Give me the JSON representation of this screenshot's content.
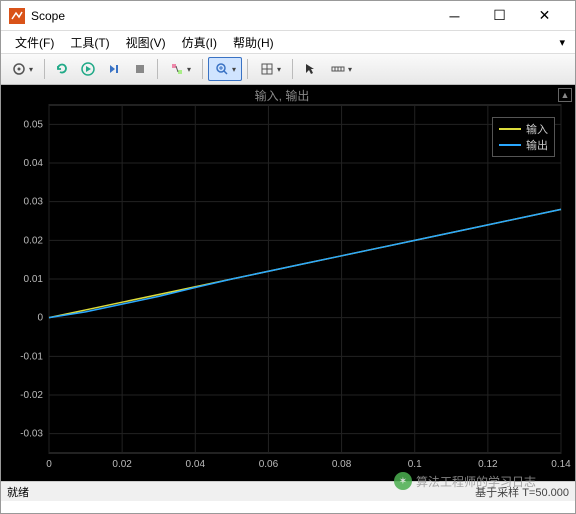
{
  "window": {
    "title": "Scope"
  },
  "menu": {
    "file": "文件(F)",
    "tools": "工具(T)",
    "view": "视图(V)",
    "simulation": "仿真(I)",
    "help": "帮助(H)"
  },
  "chart_data": {
    "type": "line",
    "title": "输入, 输出",
    "xlabel": "",
    "ylabel": "",
    "xlim": [
      0,
      0.14
    ],
    "ylim": [
      -0.035,
      0.055
    ],
    "xticks": [
      0,
      0.02,
      0.04,
      0.06,
      0.08,
      0.1,
      0.12,
      0.14
    ],
    "yticks": [
      -0.03,
      -0.02,
      -0.01,
      0,
      0.01,
      0.02,
      0.03,
      0.04,
      0.05
    ],
    "series": [
      {
        "name": "输入",
        "color": "#dcdc3c",
        "x": [
          0,
          0.01,
          0.02,
          0.03,
          0.04,
          0.05,
          0.06,
          0.07,
          0.08,
          0.09,
          0.1,
          0.11,
          0.12,
          0.13,
          0.14
        ],
        "y": [
          0,
          0.002,
          0.004,
          0.006,
          0.008,
          0.01,
          0.012,
          0.014,
          0.016,
          0.018,
          0.02,
          0.022,
          0.024,
          0.026,
          0.028
        ]
      },
      {
        "name": "输出",
        "color": "#2aa8ff",
        "x": [
          0,
          0.01,
          0.02,
          0.03,
          0.04,
          0.05,
          0.06,
          0.07,
          0.08,
          0.09,
          0.1,
          0.11,
          0.12,
          0.13,
          0.14
        ],
        "y": [
          0,
          0.0015,
          0.0035,
          0.0055,
          0.0078,
          0.01,
          0.012,
          0.014,
          0.016,
          0.018,
          0.02,
          0.022,
          0.024,
          0.026,
          0.028
        ]
      }
    ]
  },
  "legend": {
    "s1": "输入",
    "s2": "输出"
  },
  "status": {
    "left": "就绪",
    "right": "基于采样 T=50.000"
  },
  "watermark": "算法工程师的学习日志"
}
